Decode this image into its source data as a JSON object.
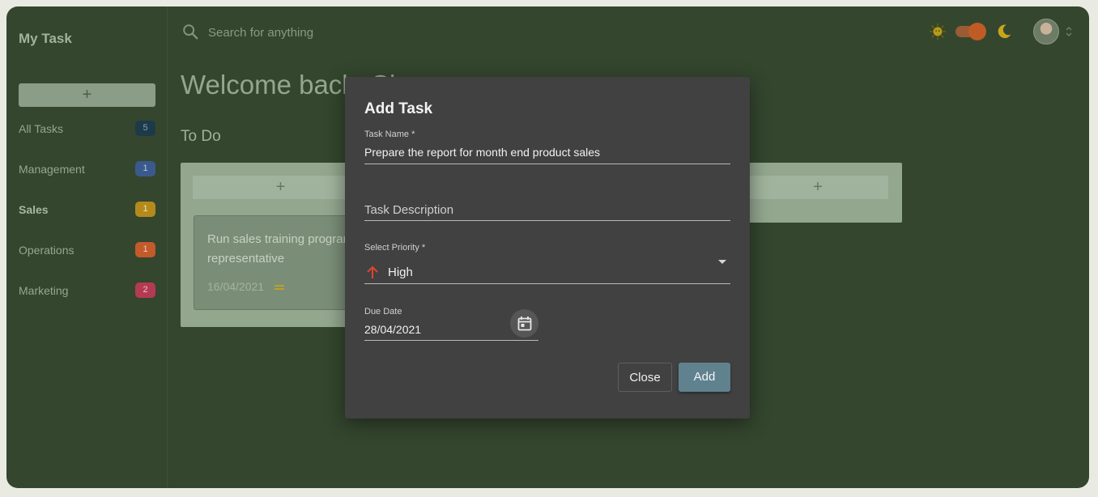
{
  "app": {
    "brand": "My Task"
  },
  "sidebar": {
    "add_label": "+",
    "items": [
      {
        "label": "All Tasks",
        "count": "5",
        "color": "#1d3a4a",
        "text_color": "#7fa2b6"
      },
      {
        "label": "Management",
        "count": "1",
        "color": "#3a5a8d",
        "text_color": "#b8c8e4"
      },
      {
        "label": "Sales",
        "count": "1",
        "color": "#b48a1c",
        "text_color": "#f4e2a8"
      },
      {
        "label": "Operations",
        "count": "1",
        "color": "#c25a2c",
        "text_color": "#f3c8ae"
      },
      {
        "label": "Marketing",
        "count": "2",
        "color": "#b33a52",
        "text_color": "#f2c0ca"
      }
    ]
  },
  "topbar": {
    "search_placeholder": "Search for anything",
    "theme": {
      "mode": "dark",
      "light_icon": "sun-icon",
      "dark_icon": "moon-icon"
    }
  },
  "main": {
    "welcome": "Welcome back, Cl",
    "column_title": "To Do",
    "add_task_label": "+",
    "task": {
      "title": "Run sales training program for all sale representative",
      "date": "16/04/2021",
      "priority_icon": "equal-icon"
    }
  },
  "modal": {
    "title": "Add Task",
    "task_name_label": "Task Name *",
    "task_name_value": "Prepare the report for month end product sales",
    "description_placeholder": "Task Description",
    "priority_label": "Select Priority *",
    "priority_value": "High",
    "priority_icon": "arrow-up-icon",
    "priority_color": "#e0452f",
    "due_label": "Due Date",
    "due_value": "28/04/2021",
    "close_label": "Close",
    "add_label": "Add"
  }
}
